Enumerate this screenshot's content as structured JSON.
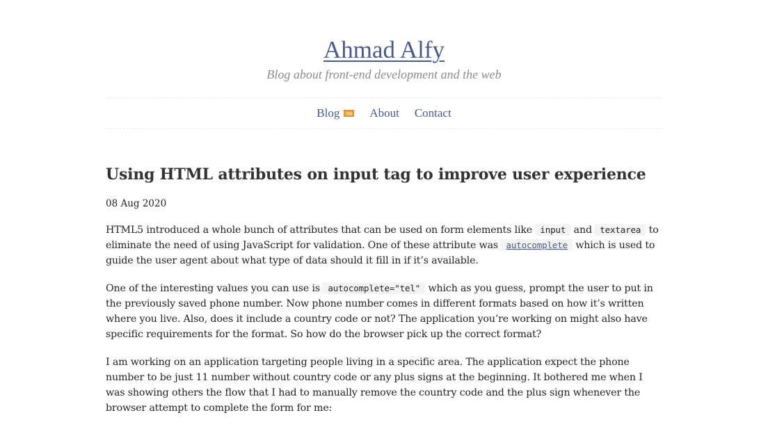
{
  "site": {
    "title": "Ahmad Alfy",
    "tagline": "Blog about front-end development and the web"
  },
  "nav": {
    "items": [
      {
        "label": "Blog",
        "icon": "rss-icon"
      },
      {
        "label": "About"
      },
      {
        "label": "Contact"
      }
    ]
  },
  "post": {
    "title": "Using HTML attributes on input tag to improve user experience",
    "date": "08 Aug 2020",
    "p1": {
      "t1": "HTML5 introduced a whole bunch of attributes that can be used on form elements like ",
      "c1": "input",
      "t2": " and ",
      "c2": "textarea",
      "t3": " to eliminate the need of using JavaScript for validation. One of these attribute was ",
      "link": "autocomplete",
      "t4": " which is used to guide the user agent about what type of data should it fill in if it’s available."
    },
    "p2": {
      "t1": "One of the interesting values you can use is ",
      "c1": "autocomplete=\"tel\"",
      "t2": " which as you guess, prompt the user to put in the previously saved phone number. Now phone number comes in different formats based on how it’s written where you live. Also, does it include a country code or not? The application you’re working on might also have specific requirements for the format. So how do the browser pick up the correct format?"
    },
    "p3": "I am working on an application targeting people living in a specific area. The application expect the phone number to be just 11 number without country code or any plus signs at the beginning. It bothered me when I was showing others the flow that I had to manually remove the country code and the plus sign whenever the browser attempt to complete the form for me:"
  }
}
